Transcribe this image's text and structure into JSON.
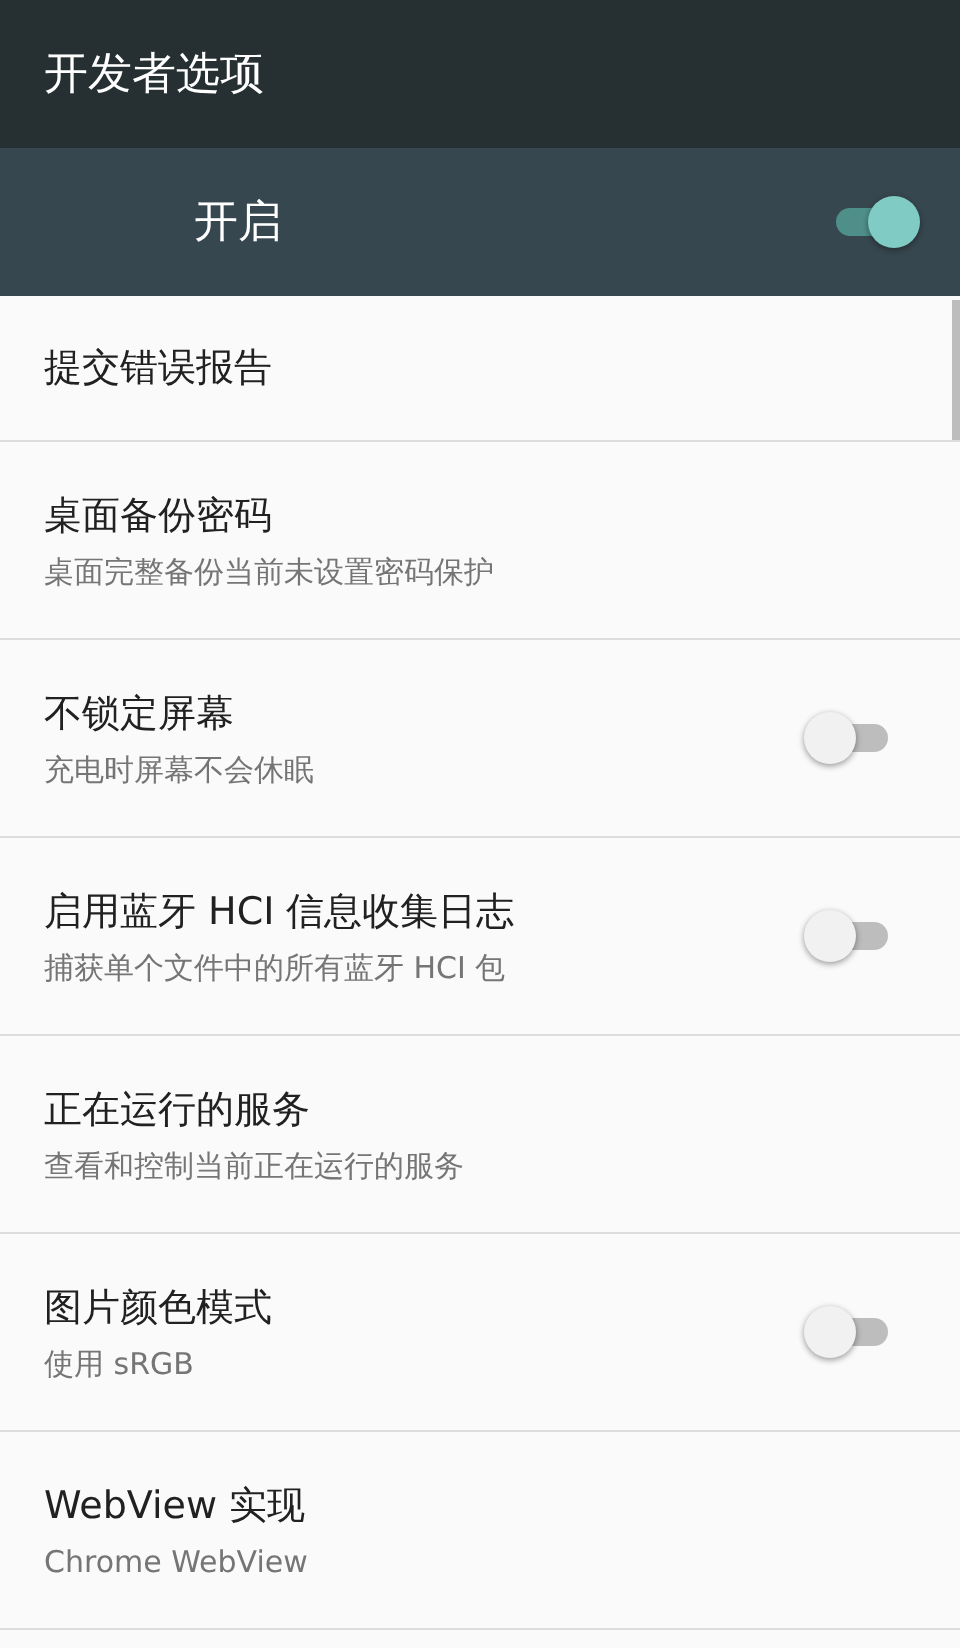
{
  "app_bar": {
    "title": "开发者选项"
  },
  "master_switch": {
    "label": "开启",
    "on": true
  },
  "settings": [
    {
      "kind": "plain",
      "title": "提交错误报告"
    },
    {
      "kind": "plain",
      "title": "桌面备份密码",
      "summary": "桌面完整备份当前未设置密码保护"
    },
    {
      "kind": "switch",
      "title": "不锁定屏幕",
      "summary": "充电时屏幕不会休眠",
      "on": false
    },
    {
      "kind": "switch",
      "title": "启用蓝牙 HCI 信息收集日志",
      "summary": "捕获单个文件中的所有蓝牙 HCI 包",
      "on": false
    },
    {
      "kind": "plain",
      "title": "正在运行的服务",
      "summary": "查看和控制当前正在运行的服务"
    },
    {
      "kind": "switch",
      "title": "图片颜色模式",
      "summary": "使用 sRGB",
      "on": false
    },
    {
      "kind": "plain",
      "title": "WebView 实现",
      "summary": "Chrome WebView"
    }
  ]
}
